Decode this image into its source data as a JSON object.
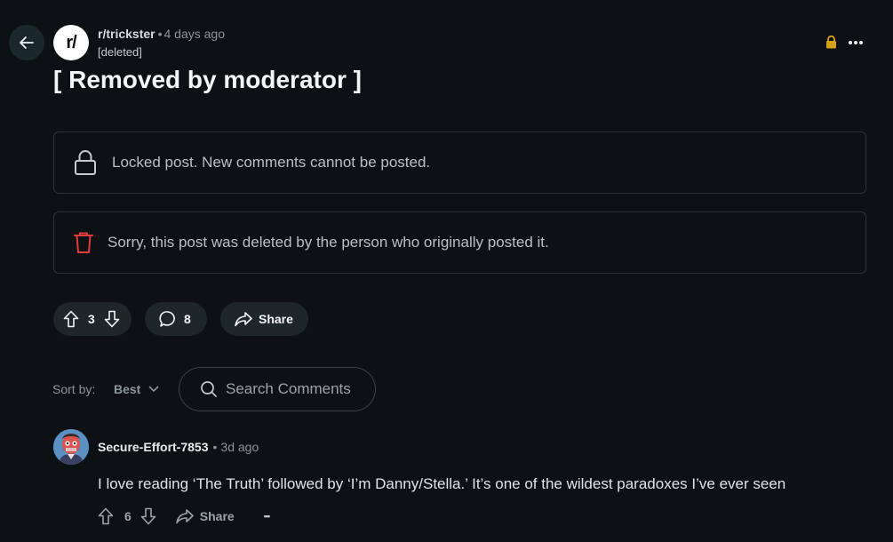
{
  "post": {
    "subreddit": "r/trickster",
    "subreddit_icon_text": "r/",
    "time_ago": "4 days ago",
    "author": "[deleted]",
    "title": "[ Removed by moderator ]",
    "locked_notice": "Locked post. New comments cannot be posted.",
    "deleted_notice": "Sorry, this post was deleted by the person who originally posted it.",
    "vote_count": "3",
    "comment_count": "8",
    "share_label": "Share"
  },
  "sort": {
    "label": "Sort by:",
    "value": "Best"
  },
  "search": {
    "placeholder": "Search Comments"
  },
  "comment": {
    "author": "Secure-Effort-7853",
    "time_ago": "3d ago",
    "body": "I love reading ‘The Truth’ followed by ‘I’m Danny/Stella.’ It’s one of the wildest paradoxes I’ve ever seen",
    "vote_count": "6",
    "share_label": "Share",
    "more_label": "•••"
  },
  "colors": {
    "background": "#0e1113",
    "lock_accent": "#d4a017",
    "delete_accent": "#e03c3c"
  }
}
